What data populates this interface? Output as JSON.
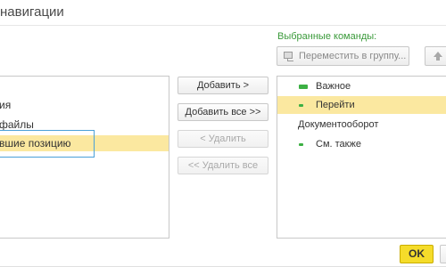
{
  "window": {
    "title": "навигации"
  },
  "selected_commands_label": "Выбранные команды:",
  "toolbar": {
    "move_to_group_label": "Переместить в группу...",
    "move_up_icon": "arrow-up-icon"
  },
  "left_list": {
    "items": [
      {
        "label": "ия",
        "selected": false
      },
      {
        "label": "файлы",
        "selected": false
      },
      {
        "label": "вшие позицию",
        "selected": true
      }
    ]
  },
  "actions": {
    "add": "Добавить >",
    "add_all": "Добавить все >>",
    "remove": "< Удалить",
    "remove_all": "<< Удалить все"
  },
  "right_list": {
    "items": [
      {
        "label": "Важное",
        "icon": "green-bar-icon",
        "selected": false
      },
      {
        "label": "Перейти",
        "icon": "green-dash-icon",
        "selected": true
      },
      {
        "label": "Документооборот",
        "icon": "",
        "selected": false
      },
      {
        "label": "См. также",
        "icon": "green-dash-icon",
        "selected": false
      }
    ]
  },
  "footer": {
    "ok_label": "OK"
  },
  "colors": {
    "accent_green": "#3a9a3a",
    "selection": "#fbe8a0",
    "ok_button": "#f5dc2a",
    "focus_border": "#4aa0d8"
  }
}
